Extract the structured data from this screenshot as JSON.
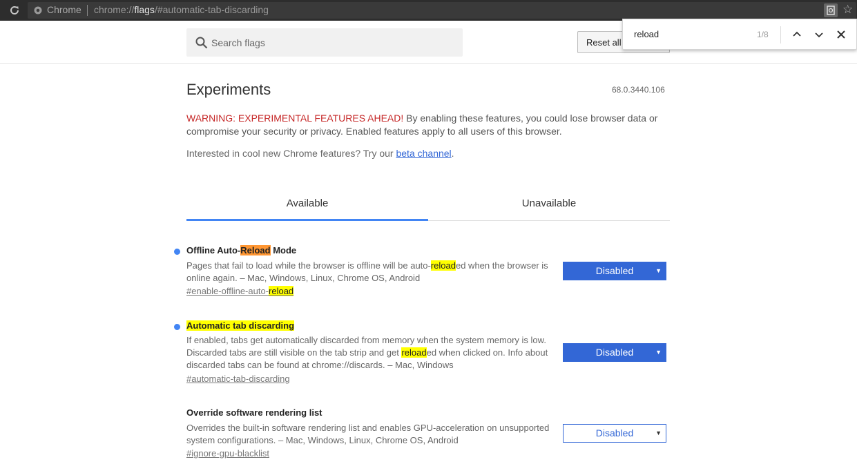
{
  "browser": {
    "brand": "Chrome",
    "url_scheme": "chrome://",
    "url_host": "flags",
    "url_path": "/#automatic-tab-discarding"
  },
  "header": {
    "search_placeholder": "Search flags",
    "reset_label": "Reset all"
  },
  "findbar": {
    "query": "reload",
    "count": "1/8"
  },
  "page": {
    "title": "Experiments",
    "version": "68.0.3440.106",
    "warning_red": "WARNING: EXPERIMENTAL FEATURES AHEAD!",
    "warning_rest": " By enabling these features, you could lose browser data or compromise your security or privacy. Enabled features apply to all users of this browser.",
    "interest_text": "Interested in cool new Chrome features? Try our ",
    "interest_link": "beta channel",
    "interest_end": "."
  },
  "tabs": {
    "available": "Available",
    "unavailable": "Unavailable"
  },
  "experiments": [
    {
      "name_pre": "Offline Auto-",
      "name_hl": "Reload",
      "name_post": " Mode",
      "desc_pre": "Pages that fail to load while the browser is offline will be auto-",
      "desc_hl": "reload",
      "desc_post": "ed when the browser is online again. – Mac, Windows, Linux, Chrome OS, Android",
      "link_pre": "#enable-offline-auto-",
      "link_hl": "reload",
      "select_value": "Disabled"
    },
    {
      "name": "Automatic tab discarding",
      "desc_pre": "If enabled, tabs get automatically discarded from memory when the system memory is low. Discarded tabs are still visible on the tab strip and get ",
      "desc_hl": "reload",
      "desc_post": "ed when clicked on. Info about discarded tabs can be found at chrome://discards. – Mac, Windows",
      "link": "#automatic-tab-discarding",
      "select_value": "Disabled"
    },
    {
      "name": "Override software rendering list",
      "desc": "Overrides the built-in software rendering list and enables GPU-acceleration on unsupported system configurations. – Mac, Windows, Linux, Chrome OS, Android",
      "link": "#ignore-gpu-blacklist",
      "select_value": "Disabled"
    }
  ],
  "colors": {
    "accent": "#3367d6",
    "tab_indicator": "#4285f4",
    "warning": "#c62828",
    "highlight": "#ffff00",
    "active_highlight": "#ff9632"
  }
}
